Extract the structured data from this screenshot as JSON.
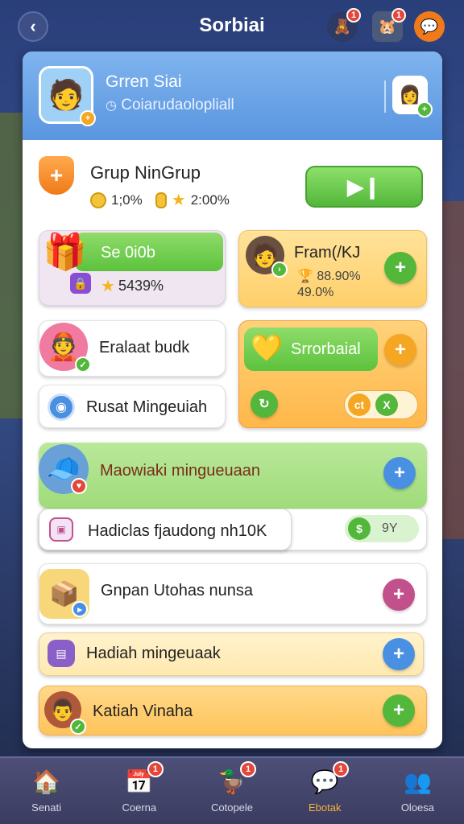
{
  "header": {
    "title": "Sorbiai",
    "top_badges": [
      "1",
      "1"
    ]
  },
  "profile": {
    "name": "Grren Siai",
    "subtitle": "Coiarudaolopliall"
  },
  "group": {
    "title": "Grup NinGrup",
    "stat_a": "1;0%",
    "stat_b": "2:00%"
  },
  "cards": {
    "gift_card": {
      "label": "Se 0i0b",
      "value": "5439%"
    },
    "friend_card": {
      "label": "Fram(/KJ",
      "value_a": "88.90%",
      "value_b": "49.0%"
    },
    "person_card": {
      "label": "Eralaat budk"
    },
    "gold_card": {
      "label": "Srrorbaial",
      "ok_label": "ct",
      "x_label": "X"
    },
    "rusat_card": {
      "label": "Rusat Mingeuiah"
    },
    "green_row": {
      "label": "Maowiaki mingueuaan"
    },
    "hadiclas_row": {
      "label": "Hadiclas fjaudong nh10K",
      "dollar_label": "$",
      "tag": "9Y"
    },
    "gnpan_row": {
      "label": "Gnpan Utohas nunsa"
    },
    "hadiah_row": {
      "label": "Hadiah mingeuaak"
    },
    "katiah_row": {
      "label": "Katiah Vinaha"
    }
  },
  "nav": [
    {
      "label": "Senati",
      "badge": ""
    },
    {
      "label": "Coerna",
      "badge": "1"
    },
    {
      "label": "Cotopele",
      "badge": "1"
    },
    {
      "label": "Ebotak",
      "badge": "1"
    },
    {
      "label": "Oloesa",
      "badge": ""
    }
  ],
  "colors": {
    "accent_green": "#52b73a",
    "accent_orange": "#f5a623",
    "accent_blue": "#4a90e2",
    "accent_pink": "#c2508a",
    "active_nav": "#f5b33a"
  }
}
